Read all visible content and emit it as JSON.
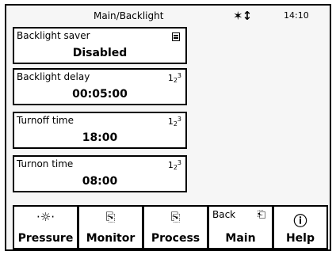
{
  "header": {
    "title": "Main/Backlight",
    "signal_icon": "signal-antenna-icon",
    "time": "14:10"
  },
  "fields": [
    {
      "label": "Backlight saver",
      "value": "Disabled",
      "icon": "menu-list-icon"
    },
    {
      "label": "Backlight delay",
      "value": "00:05:00",
      "icon": "numeric-input-icon"
    },
    {
      "label": "Turnoff time",
      "value": "18:00",
      "icon": "numeric-input-icon"
    },
    {
      "label": "Turnon time",
      "value": "08:00",
      "icon": "numeric-input-icon"
    }
  ],
  "buttons": [
    {
      "label": "Pressure",
      "icon": "pressure-icon"
    },
    {
      "label": "Monitor",
      "icon": "monitor-icon"
    },
    {
      "label": "Process",
      "icon": "process-icon"
    },
    {
      "label": "Main",
      "prefix": "Back",
      "icon": "back-icon"
    },
    {
      "label": "Help",
      "icon": "help-icon"
    }
  ]
}
